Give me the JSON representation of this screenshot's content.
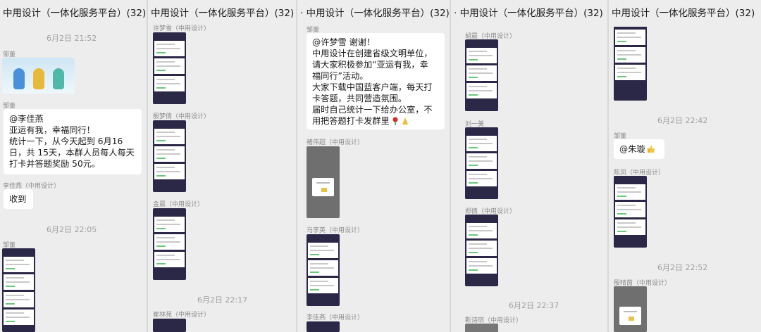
{
  "columns": [
    {
      "title": "中用设计（一体化服务平台）(32)",
      "time1": "6月2日 21:52",
      "sender_mascot": "邹董",
      "sender_msg": "邹董",
      "msg1": [
        "@李佳燕",
        "亚运有我，幸福同行！",
        "统计一下，从今天起到 6月16",
        "日，共 15天，本群人员每人每天",
        "打卡并答题奖励 50元。"
      ],
      "sender_reply": "李佳燕（中用设计）",
      "reply": "收到",
      "time2": "6月2日 22:05",
      "sender_shot": "邹董"
    },
    {
      "title": "中用设计（一体化服务平台）(32)",
      "senders": [
        "许梦雪（中用设计）",
        "殷梦倩（中用设计）",
        "金晨（中用设计）",
        "崔林苑（中用设计）"
      ],
      "time": "6月2日 22:17"
    },
    {
      "title": "· 中用设计（一体化服务平台）(32)",
      "sender_msg": "邹董",
      "msg": [
        "@许梦雪 谢谢！",
        "中用设计在创建省级文明单位，",
        "请大家积极参加“亚运有我，幸",
        "福同行”活动。",
        "大家下载中国蓝客户端，每天打",
        "卡答题，共同营造氛围。",
        "届时自己统计一下给办公室，不",
        "用把答题打卡发群里"
      ],
      "senders": [
        "褚伟超（中用设计）",
        "马李英（中用设计）",
        "李佳燕（中用设计）"
      ]
    },
    {
      "title": "· 中用设计（一体化服务平台）(32)",
      "senders": [
        "胡晨（中用设计）",
        "刘一美",
        "郑倩（中用设计）",
        "靳诗琪（中用设计）"
      ],
      "time": "6月2日 22:37"
    },
    {
      "title": "中用设计（一体化服务平台）(32)",
      "time1": "6月2日 22:42",
      "sender_msg": "邹董",
      "msg": "@朱璇",
      "senders": [
        "陈凤（中用设计）",
        "殷晴茵（中用设计）"
      ],
      "time2": "6月2日 22:52"
    }
  ]
}
